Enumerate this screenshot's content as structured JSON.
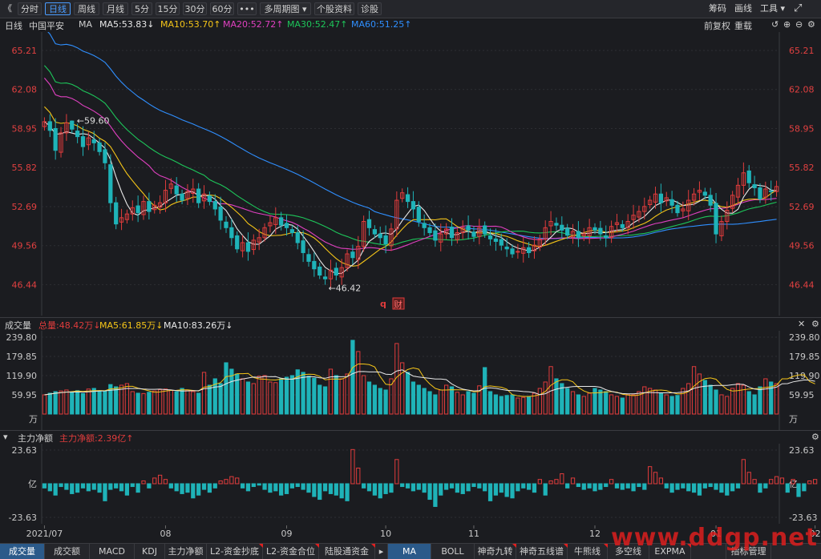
{
  "toolbar": {
    "back_icon": "《",
    "periods": [
      "分时",
      "日线",
      "周线",
      "月线",
      "5分",
      "15分",
      "30分",
      "60分",
      "•••",
      "多周期图 ▾",
      "个股资料",
      "诊股"
    ],
    "active_period": "日线",
    "right_items": [
      "筹码",
      "画线",
      "工具 ▾"
    ],
    "expand_icon": "expand-icon"
  },
  "infobar": {
    "period_label": "日线",
    "stock_name": "中国平安",
    "ma_label": "MA",
    "ma5": "MA5:53.83↓",
    "ma10": "MA10:53.70↑",
    "ma20": "MA20:52.72↑",
    "ma30": "MA30:52.47↑",
    "ma60": "MA60:51.25↑",
    "adjust_label": "前复权",
    "reload_label": "重载",
    "colors": {
      "ma5": "#e8e8e8",
      "ma10": "#f5c518",
      "ma20": "#e040c0",
      "ma30": "#1dc65a",
      "ma60": "#2f8fff"
    }
  },
  "price_axis": {
    "ticks": [
      "65.21",
      "62.08",
      "58.95",
      "55.82",
      "52.69",
      "49.56",
      "46.44"
    ],
    "values": [
      65.21,
      62.08,
      58.95,
      55.82,
      52.69,
      49.56,
      46.44
    ],
    "ylim": [
      44.6,
      66.3
    ]
  },
  "price_annotations": {
    "high_label": "59.60",
    "low_label": "46.42",
    "markers": [
      "q",
      "财"
    ]
  },
  "volume": {
    "header_label": "成交量",
    "total": "总量:48.42万↓",
    "ma5": "MA5:61.85万↓",
    "ma10": "MA10:83.26万↓",
    "ticks": [
      "239.80",
      "179.85",
      "119.90",
      "59.95"
    ],
    "tick_values": [
      239.8,
      179.85,
      119.9,
      59.95
    ],
    "unit": "万",
    "ylim": [
      0,
      239.8
    ]
  },
  "flow": {
    "header_label": "主力净额",
    "value_label": "主力净额:2.39亿↑",
    "ticks": [
      "23.63",
      "亿",
      "-23.63"
    ],
    "ylim": [
      -23.63,
      23.63
    ]
  },
  "x_axis": {
    "labels": [
      "2021/07",
      "08",
      "09",
      "10",
      "11",
      "12",
      "01",
      "02"
    ],
    "label_index": [
      0,
      22,
      44,
      62,
      78,
      100,
      122,
      140
    ]
  },
  "bottom_tabs": [
    "成交量",
    "成交额",
    "MACD",
    "KDJ",
    "主力净额",
    "L2-资金抄底",
    "L2-资金合位",
    "陆股通资金",
    "▸",
    "MA",
    "BOLL",
    "神奇九转",
    "神奇五线谱",
    "牛熊线",
    "多空线",
    "EXPMA",
    "",
    "指标管理"
  ],
  "watermark": "www.ddgp.net",
  "chart_data": {
    "type": "candlestick",
    "title": "",
    "series": [
      {
        "name": "中国平安",
        "close": [
          59.5,
          58.8,
          57.2,
          58.6,
          59.4,
          58.9,
          58.3,
          57.5,
          58.2,
          57.8,
          57.1,
          56.2,
          53.0,
          51.3,
          51.8,
          52.1,
          52.6,
          52.2,
          53.1,
          52.3,
          52.8,
          53.0,
          54.0,
          54.5,
          53.7,
          53.2,
          53.9,
          54.1,
          53.0,
          53.7,
          53.1,
          52.5,
          51.6,
          51.0,
          50.2,
          49.3,
          49.8,
          49.1,
          50.0,
          50.2,
          51.0,
          51.4,
          51.8,
          51.2,
          51.0,
          50.6,
          49.8,
          49.0,
          48.3,
          47.7,
          47.2,
          46.9,
          47.6,
          47.2,
          47.8,
          48.9,
          48.6,
          49.5,
          51.5,
          51.0,
          50.5,
          50.2,
          49.7,
          50.9,
          53.2,
          53.8,
          53.1,
          52.5,
          51.5,
          51.0,
          50.6,
          50.0,
          50.5,
          50.9,
          50.2,
          50.6,
          51.0,
          50.8,
          50.3,
          51.0,
          50.5,
          50.1,
          49.9,
          49.6,
          49.3,
          48.9,
          49.1,
          49.4,
          49.0,
          49.6,
          50.1,
          51.0,
          51.5,
          51.2,
          50.8,
          50.4,
          50.7,
          50.2,
          50.5,
          51.0,
          50.8,
          50.5,
          50.2,
          51.1,
          51.4,
          51.0,
          51.5,
          52.0,
          52.3,
          52.7,
          53.2,
          53.7,
          53.0,
          53.4,
          52.8,
          52.2,
          52.5,
          53.2,
          53.7,
          54.0,
          53.6,
          52.8,
          50.5,
          51.5,
          52.4,
          53.6,
          54.4,
          55.4,
          54.6,
          54.2,
          53.3,
          54.1,
          53.9,
          54.3
        ]
      }
    ],
    "ma_lines": {
      "MA5": 53.83,
      "MA10": 53.7,
      "MA20": 52.72,
      "MA30": 52.47,
      "MA60": 51.25
    },
    "volume": [
      60,
      65,
      70,
      72,
      75,
      68,
      73,
      64,
      78,
      80,
      72,
      70,
      92,
      85,
      90,
      95,
      70,
      65,
      64,
      68,
      72,
      76,
      78,
      74,
      70,
      80,
      75,
      70,
      65,
      130,
      90,
      110,
      95,
      160,
      140,
      125,
      110,
      100,
      95,
      118,
      120,
      100,
      98,
      110,
      115,
      120,
      138,
      130,
      118,
      112,
      90,
      85,
      140,
      120,
      110,
      125,
      230,
      195,
      120,
      100,
      90,
      80,
      75,
      110,
      220,
      160,
      130,
      100,
      90,
      80,
      70,
      60,
      75,
      90,
      85,
      68,
      60,
      70,
      65,
      88,
      145,
      70,
      60,
      55,
      58,
      60,
      50,
      52,
      55,
      65,
      80,
      100,
      148,
      110,
      95,
      80,
      70,
      60,
      55,
      65,
      80,
      75,
      70,
      60,
      55,
      50,
      62,
      60,
      70,
      85,
      80,
      75,
      65,
      60,
      55,
      58,
      80,
      95,
      148,
      125,
      105,
      90,
      75,
      60,
      55,
      80,
      95,
      90,
      70,
      60,
      85,
      110,
      100,
      95,
      160,
      85,
      148,
      120,
      100,
      55,
      48
    ],
    "flow": [
      -3,
      -5,
      -8,
      -2,
      -4,
      -7,
      -6,
      -3,
      -5,
      -4,
      -6,
      -12,
      -4,
      -3,
      -5,
      -8,
      -2,
      -6,
      2,
      -3,
      4,
      6,
      3,
      -3,
      -5,
      -7,
      -6,
      -10,
      -8,
      -4,
      -6,
      -3,
      2,
      3,
      5,
      4,
      -3,
      -5,
      -2,
      -1,
      -4,
      -6,
      -5,
      -8,
      -7,
      -3,
      -2,
      -4,
      -6,
      -9,
      -11,
      -5,
      -7,
      -8,
      -10,
      -12,
      24,
      11,
      -3,
      -5,
      -8,
      -10,
      -7,
      -6,
      17,
      -2,
      -3,
      -5,
      -4,
      -6,
      -11,
      -16,
      -8,
      -4,
      -3,
      -6,
      -7,
      -5,
      -2,
      -3,
      -5,
      -12,
      -8,
      -6,
      -9,
      -10,
      -5,
      -3,
      -4,
      -6,
      3,
      -8,
      2,
      3,
      7,
      -3,
      4,
      -2,
      -4,
      -3,
      -5,
      -4,
      -2,
      3,
      -3,
      -4,
      -3,
      -5,
      -2,
      -4,
      12,
      8,
      4,
      -3,
      -6,
      -4,
      -3,
      -5,
      -6,
      -8,
      -3,
      -2,
      -4,
      -6,
      -8,
      -5,
      -3,
      17,
      8,
      3,
      -6,
      -3,
      3,
      5,
      4,
      -6,
      3,
      -9,
      -5,
      2,
      3
    ]
  }
}
